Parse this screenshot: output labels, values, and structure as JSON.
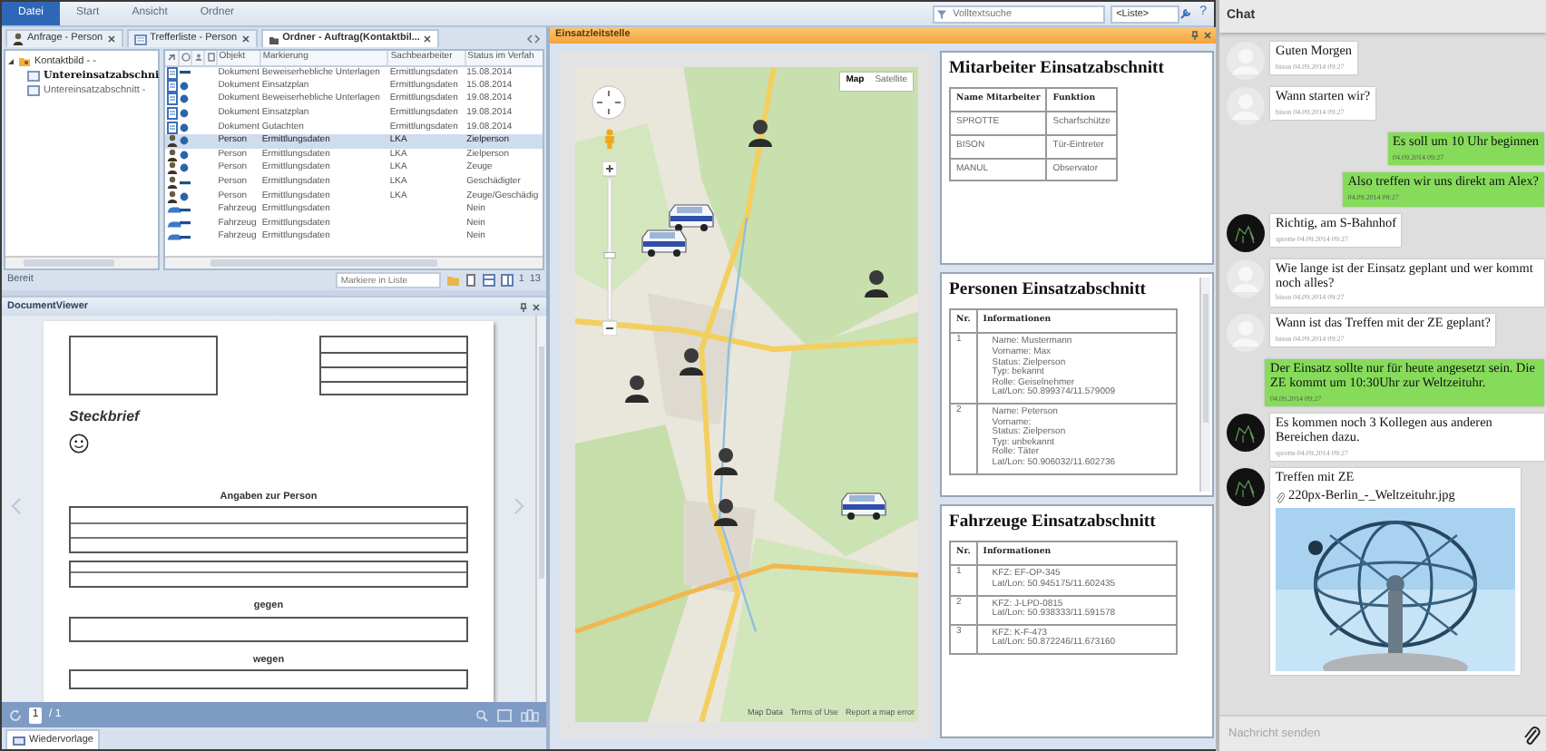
{
  "ribbon": {
    "tabs": [
      {
        "label": "Datei",
        "selected": true
      },
      {
        "label": "Start",
        "selected": false
      },
      {
        "label": "Ansicht",
        "selected": false
      },
      {
        "label": "Ordner",
        "selected": false
      }
    ],
    "search": {
      "placeholder": "Volltextsuche"
    },
    "list_select": "<Liste>",
    "help": "?"
  },
  "doc_tabs": [
    {
      "label": "Anfrage - Person",
      "kind": "query",
      "selected": false
    },
    {
      "label": "Trefferliste - Person",
      "kind": "list",
      "selected": false
    },
    {
      "label": "Ordner - Auftrag(Kontaktbil...",
      "kind": "folder",
      "selected": true
    }
  ],
  "tree": [
    {
      "label": "Kontaktbild - -",
      "expanded": true,
      "children": [
        {
          "label": "Untereinsatzabschni",
          "selected": true
        },
        {
          "label": "Untereinsatzabschnitt -",
          "selected": false
        }
      ]
    }
  ],
  "grid": {
    "columns": [
      "Objekt",
      "Markierung",
      "Sachbearbeiter",
      "Status im Verfah"
    ],
    "rows": [
      {
        "kind": "document",
        "linked": false,
        "selected": false,
        "cells": [
          "Dokument",
          "Beweiserhebliche Unterlagen",
          "Ermittlungsdaten",
          "15.08.2014"
        ]
      },
      {
        "kind": "document",
        "linked": true,
        "selected": false,
        "cells": [
          "Dokument",
          "Einsatzplan",
          "Ermittlungsdaten",
          "15.08.2014"
        ]
      },
      {
        "kind": "document",
        "linked": true,
        "selected": false,
        "cells": [
          "Dokument",
          "Beweiserhebliche Unterlagen",
          "Ermittlungsdaten",
          "19.08.2014"
        ]
      },
      {
        "kind": "document",
        "linked": true,
        "selected": false,
        "cells": [
          "Dokument",
          "Einsatzplan",
          "Ermittlungsdaten",
          "19.08.2014"
        ]
      },
      {
        "kind": "document",
        "linked": true,
        "selected": false,
        "cells": [
          "Dokument",
          "Gutachten",
          "Ermittlungsdaten",
          "19.08.2014"
        ]
      },
      {
        "kind": "person",
        "linked": true,
        "selected": true,
        "cells": [
          "Person",
          "Ermittlungsdaten",
          "LKA",
          "Zielperson"
        ]
      },
      {
        "kind": "person",
        "linked": true,
        "selected": false,
        "cells": [
          "Person",
          "Ermittlungsdaten",
          "LKA",
          "Zielperson"
        ]
      },
      {
        "kind": "person",
        "linked": true,
        "selected": false,
        "cells": [
          "Person",
          "Ermittlungsdaten",
          "LKA",
          "Zeuge"
        ]
      },
      {
        "kind": "person",
        "linked": false,
        "selected": false,
        "cells": [
          "Person",
          "Ermittlungsdaten",
          "LKA",
          "Geschädigter"
        ]
      },
      {
        "kind": "person",
        "linked": true,
        "selected": false,
        "cells": [
          "Person",
          "Ermittlungsdaten",
          "LKA",
          "Zeuge/Geschädig"
        ]
      },
      {
        "kind": "vehicle",
        "linked": false,
        "selected": false,
        "cells": [
          "Fahrzeug",
          "Ermittlungsdaten",
          null,
          "Nein"
        ]
      },
      {
        "kind": "vehicle",
        "linked": false,
        "selected": false,
        "cells": [
          "Fahrzeug",
          "Ermittlungsdaten",
          null,
          "Nein"
        ]
      },
      {
        "kind": "vehicle",
        "linked": false,
        "selected": false,
        "cells": [
          "Fahrzeug",
          "Ermittlungsdaten",
          null,
          "Nein"
        ]
      }
    ]
  },
  "status_bar": {
    "text": "Bereit",
    "filter": {
      "placeholder": "Markiere in Liste"
    },
    "page": "1",
    "count": "13"
  },
  "document_viewer": {
    "title": "DocumentViewer",
    "heading": "Steckbrief",
    "sections": [
      "Angaben zur Person",
      "gegen",
      "wegen"
    ],
    "page": "1",
    "page_total": "/ 1",
    "tab": "Wiedervorlage"
  },
  "dispatch": {
    "title": "Einsatzleitstelle",
    "map": {
      "map_types": [
        {
          "label": "Map",
          "selected": true
        },
        {
          "label": "Satellite",
          "selected": false
        }
      ],
      "markers": [
        {
          "kind": "person"
        },
        {
          "kind": "vehicle"
        },
        {
          "kind": "vehicle"
        },
        {
          "kind": "person"
        },
        {
          "kind": "person"
        },
        {
          "kind": "person"
        },
        {
          "kind": "person"
        },
        {
          "kind": "person"
        },
        {
          "kind": "vehicle"
        }
      ],
      "zoom": {
        "level": 0.45
      },
      "attribution": [
        "Map Data",
        "Terms of Use",
        "Report a map error"
      ]
    },
    "staff": {
      "title": "Mitarbeiter Einsatzabschnitt",
      "columns": [
        "Name Mitarbeiter",
        "Funktion"
      ],
      "rows": [
        [
          "SPROTTE",
          "Scharfschütze"
        ],
        [
          "BISON",
          "Tür-Eintreter"
        ],
        [
          "MANUL",
          "Observator"
        ]
      ]
    },
    "persons": {
      "title": "Personen Einsatzabschnitt",
      "columns": [
        "Nr.",
        "Informationen"
      ],
      "rows": [
        {
          "nr": "1",
          "lines": [
            "Name: Mustermann",
            "Vorname: Max",
            "Status: Zielperson",
            "Typ: bekannt",
            "Rolle: Geiselnehmer",
            "Lat/Lon: 50.899374/11.579009"
          ]
        },
        {
          "nr": "2",
          "lines": [
            "Name: Peterson",
            "Vorname:",
            "Status: Zielperson",
            "Typ: unbekannt",
            "Rolle: Täter",
            "Lat/Lon: 50.906032/11.602736"
          ]
        }
      ]
    },
    "vehicles": {
      "title": "Fahrzeuge Einsatzabschnitt",
      "columns": [
        "Nr.",
        "Informationen"
      ],
      "rows": [
        {
          "nr": "1",
          "lines": [
            "KFZ: EF-OP-345",
            "Lat/Lon: 50.945175/11.602435"
          ]
        },
        {
          "nr": "2",
          "lines": [
            "KFZ: J-LPD-0815",
            "Lat/Lon: 50.938333/11.591578"
          ]
        },
        {
          "nr": "3",
          "lines": [
            "KFZ: K-F-473",
            "Lat/Lon: 50.872246/11.673160"
          ]
        }
      ]
    }
  },
  "chat": {
    "title": "Chat",
    "messages": [
      {
        "kind": "incoming",
        "avatar": {
          "kind": "blank"
        },
        "text": "Guten Morgen",
        "meta": "bison 04.09.2014 09:27"
      },
      {
        "kind": "incoming",
        "avatar": {
          "kind": "blank"
        },
        "text": "Wann starten wir?",
        "meta": "bison 04.09.2014 09:27"
      },
      {
        "kind": "outgoing",
        "text": "Es soll um 10 Uhr beginnen",
        "meta": "04.09.2014 09:27"
      },
      {
        "kind": "outgoing",
        "text": "Also treffen wir uns direkt am Alex?",
        "meta": "04.09.2014 09:27"
      },
      {
        "kind": "incoming",
        "avatar": {
          "kind": "dark"
        },
        "text": "Richtig, am S-Bahnhof",
        "meta": "sprotte 04.09.2014 09:27"
      },
      {
        "kind": "incoming",
        "avatar": {
          "kind": "blank"
        },
        "text": "Wie lange ist der Einsatz geplant und wer kommt noch alles?",
        "meta": "bison 04.09.2014 09:27"
      },
      {
        "kind": "incoming",
        "avatar": {
          "kind": "blank"
        },
        "text": "Wann ist das Treffen mit der ZE geplant?",
        "meta": "bison 04.09.2014 09:27"
      },
      {
        "kind": "outgoing",
        "text": "Der Einsatz sollte nur für heute angesetzt sein. Die ZE kommt um 10:30Uhr zur Weltzeituhr.",
        "meta": "04.09.2014 09:27"
      },
      {
        "kind": "incoming",
        "avatar": {
          "kind": "dark"
        },
        "text": "Es kommen noch 3 Kollegen aus anderen Bereichen dazu.",
        "meta": "sprotte 04.09.2014 09:27"
      },
      {
        "kind": "incoming",
        "avatar": {
          "kind": "dark"
        },
        "text": "Treffen mit ZE",
        "attachment": "220px-Berlin_-_Weltzeituhr.jpg"
      }
    ],
    "input": {
      "placeholder": "Nachricht senden"
    }
  }
}
